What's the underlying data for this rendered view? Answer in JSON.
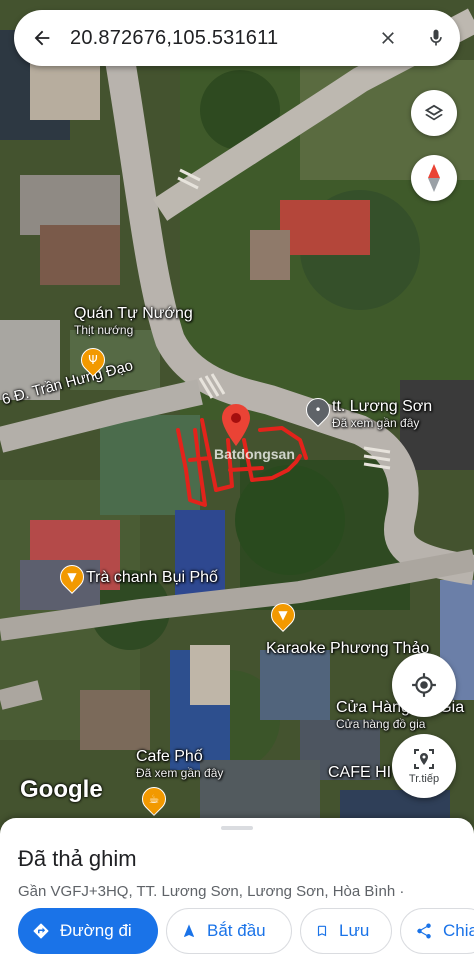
{
  "search": {
    "query": "20.872676,105.531611"
  },
  "map": {
    "labels": [
      {
        "name": "Quán Tự Nướng",
        "sub": "Thịt nướng"
      },
      {
        "name": "tt. Lương Sơn",
        "sub": "Đã xem gần đây"
      },
      {
        "name": "Trà chanh Bụi Phố",
        "sub": ""
      },
      {
        "name": "Karaoke Phương Thảo",
        "sub": ""
      },
      {
        "name": "Cửa Hàng Đồ Gia",
        "sub": "Cửa hàng đồ gia"
      },
      {
        "name": "Cafe Phố",
        "sub": "Đã xem gần đây"
      },
      {
        "name": "CAFE HI",
        "sub": ""
      }
    ],
    "road_label": "6 Đ. Trần Hưng Đạo",
    "watermark": "Batdongsan",
    "attribution": "Google"
  },
  "buttons": {
    "locate_label": "Tr.tiếp"
  },
  "sheet": {
    "title": "Đã thả ghim",
    "address": "Gần VGFJ+3HQ, TT. Lương Sơn, Lương Sơn, Hòa Bình ·",
    "actions": [
      {
        "label": "Đường đi"
      },
      {
        "label": "Bắt đầu"
      },
      {
        "label": "Lưu"
      },
      {
        "label": "Chia"
      }
    ]
  },
  "colors": {
    "accent": "#1a73e8",
    "pin": "#ea4335",
    "poi": "#f29900"
  }
}
